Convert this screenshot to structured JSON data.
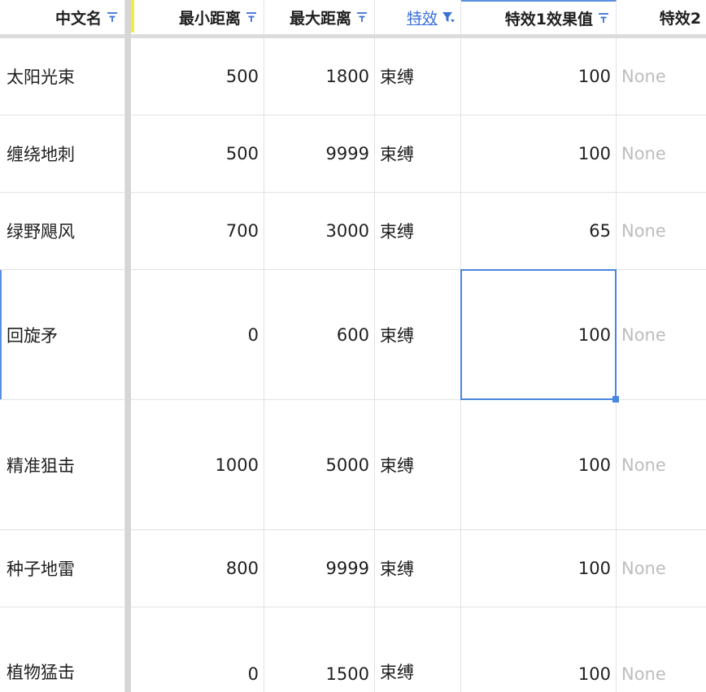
{
  "columns": [
    {
      "label": "中文名",
      "filter": "filter-icon"
    },
    {
      "label": "最小距离",
      "filter": "filter-icon"
    },
    {
      "label": "最大距离",
      "filter": "filter-icon"
    },
    {
      "label": "特效",
      "filter": "filter-active-icon"
    },
    {
      "label": "特效1效果值",
      "filter": "filter-icon"
    },
    {
      "label": "特效2",
      "filter": ""
    }
  ],
  "rows": [
    {
      "name": "太阳光束",
      "min": "500",
      "max": "1800",
      "effect": "束缚",
      "value": "100",
      "effect2": "None"
    },
    {
      "name": "缠绕地刺",
      "min": "500",
      "max": "9999",
      "effect": "束缚",
      "value": "100",
      "effect2": "None"
    },
    {
      "name": "绿野飓风",
      "min": "700",
      "max": "3000",
      "effect": "束缚",
      "value": "65",
      "effect2": "None"
    },
    {
      "name": "回旋矛",
      "min": "0",
      "max": "600",
      "effect": "束缚",
      "value": "100",
      "effect2": "None"
    },
    {
      "name": "精准狙击",
      "min": "1000",
      "max": "5000",
      "effect": "束缚",
      "value": "100",
      "effect2": "None"
    },
    {
      "name": "种子地雷",
      "min": "800",
      "max": "9999",
      "effect": "束缚",
      "value": "100",
      "effect2": "None"
    },
    {
      "name": "植物猛击",
      "min": "0",
      "max": "1500",
      "effect": "束缚",
      "value": "100",
      "effect2": "None"
    }
  ],
  "colors": {
    "accent": "#4a86e0",
    "freeze": "#d6d6d6",
    "none_text": "#bdbdbd",
    "link": "#3a6fd8"
  }
}
